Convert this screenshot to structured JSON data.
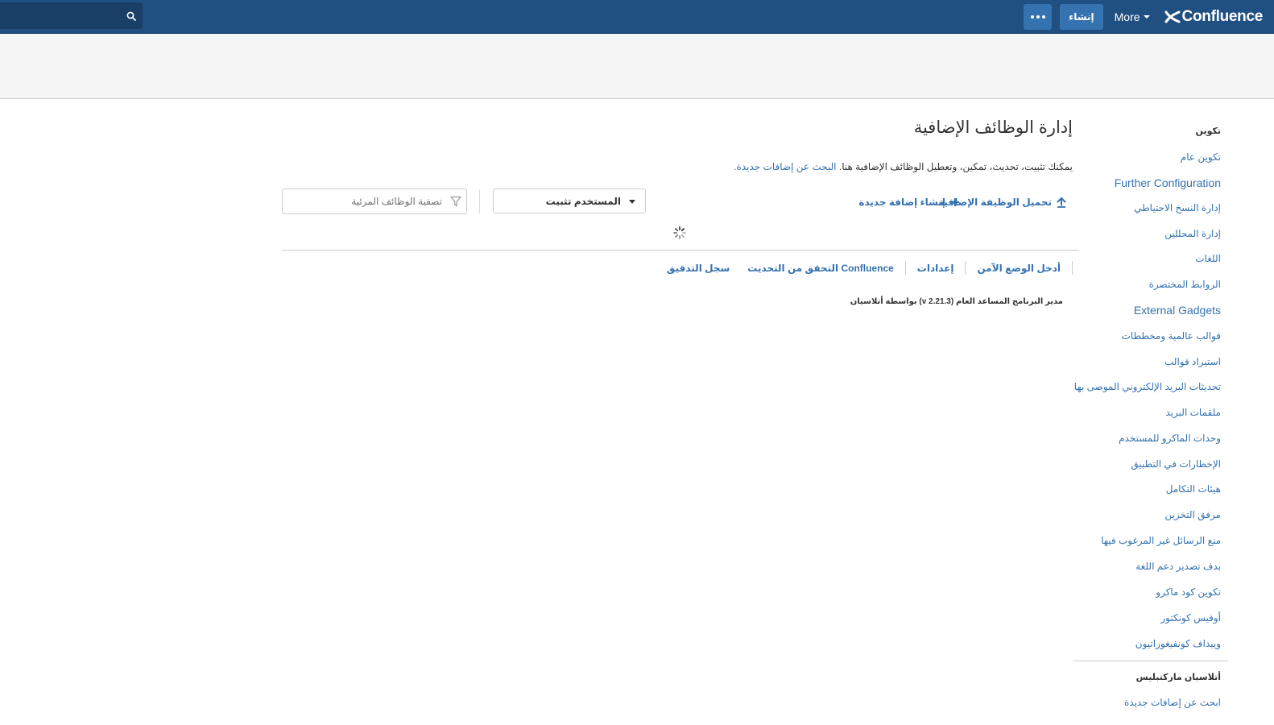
{
  "header": {
    "search_placeholder": "",
    "more_actions_icon": "ellipsis-icon",
    "create_label": "إنشاء",
    "more_label": "More",
    "logo_text": "Confluence",
    "colors": {
      "bar": "#205081",
      "button": "#3572b0"
    }
  },
  "sidebar": {
    "configuration_heading": "تكوين",
    "items": [
      "تكوين عام",
      "Further Configuration",
      "إدارة النسخ الاحتياطي",
      "إدارة المحللين",
      "اللغات",
      "الروابط المختصرة",
      "External Gadgets",
      "قوالب عالمية ومخططات",
      "استيراد قوالب",
      "تحديثات البريد الإلكتروني الموصى بها",
      "ملقمات البريد",
      "وحدات الماكرو للمستخدم",
      "الإخطارات في التطبيق",
      "هيئات التكامل",
      "مرفق التخزين",
      "منع الرسائل غير المرغوب فيها",
      "بدف تصدير دعم اللغة",
      "تكوين كود ماكرو",
      "أوفيس كونكتور",
      "ويبداف كونفيغوراتيون"
    ],
    "marketplace_heading": "أتلاسيان ماركتبليس",
    "marketplace_items": [
      "ابحث عن إضافات جديدة"
    ]
  },
  "main": {
    "title": "إدارة الوظائف الإضافية",
    "intro_text": "يمكنك تثبيت، تحديث، تمكين، وتعطيل الوظائف الإضافية هنا.",
    "intro_link": "البحث عن إضافات جديدة.",
    "upload_label": "تحميل الوظيفة الإضافية",
    "create_addon_label": "إنشاء إضافة جديدة",
    "filter_select_value": "المستخدم تثبيت",
    "filter_placeholder": "تصفية الوظائف المرئية",
    "footer_links": {
      "audit_log": "سجل التدقيق",
      "update_check": "Confluence التحقق من التحديث",
      "settings": "إعدادات",
      "safe_mode": "أدخل الوضع الآمن"
    },
    "upm_version": "مدير البرنامج المساعد العام (v 2.21.3) بواسطة أتلاسيان"
  }
}
